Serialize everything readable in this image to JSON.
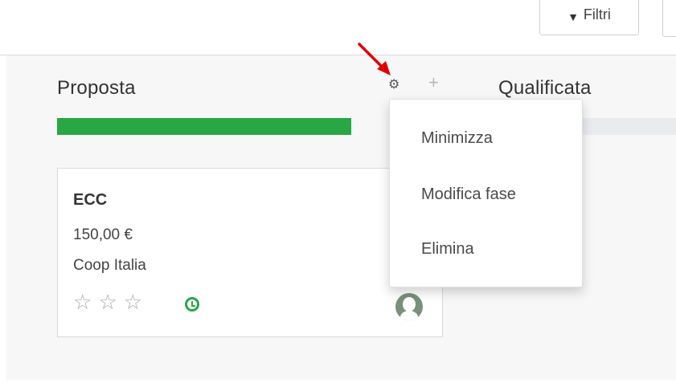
{
  "toolbar": {
    "filter_label": "Filtri"
  },
  "columns": [
    {
      "title": "Proposta"
    },
    {
      "title": "Qualificata"
    }
  ],
  "column_menu": {
    "items": [
      "Minimizza",
      "Modifica fase",
      "Elimina"
    ]
  },
  "card": {
    "title": "ECC",
    "amount": "150,00 €",
    "company": "Coop Italia",
    "stars": [
      "☆",
      "☆",
      "☆"
    ]
  },
  "colors": {
    "progress": "#28a745",
    "annotation_arrow": "#e00000"
  },
  "icons": {
    "gear": "gear-icon",
    "plus": "plus-icon",
    "filter": "filter-icon",
    "clock": "clock-icon",
    "avatar": "avatar-icon"
  }
}
